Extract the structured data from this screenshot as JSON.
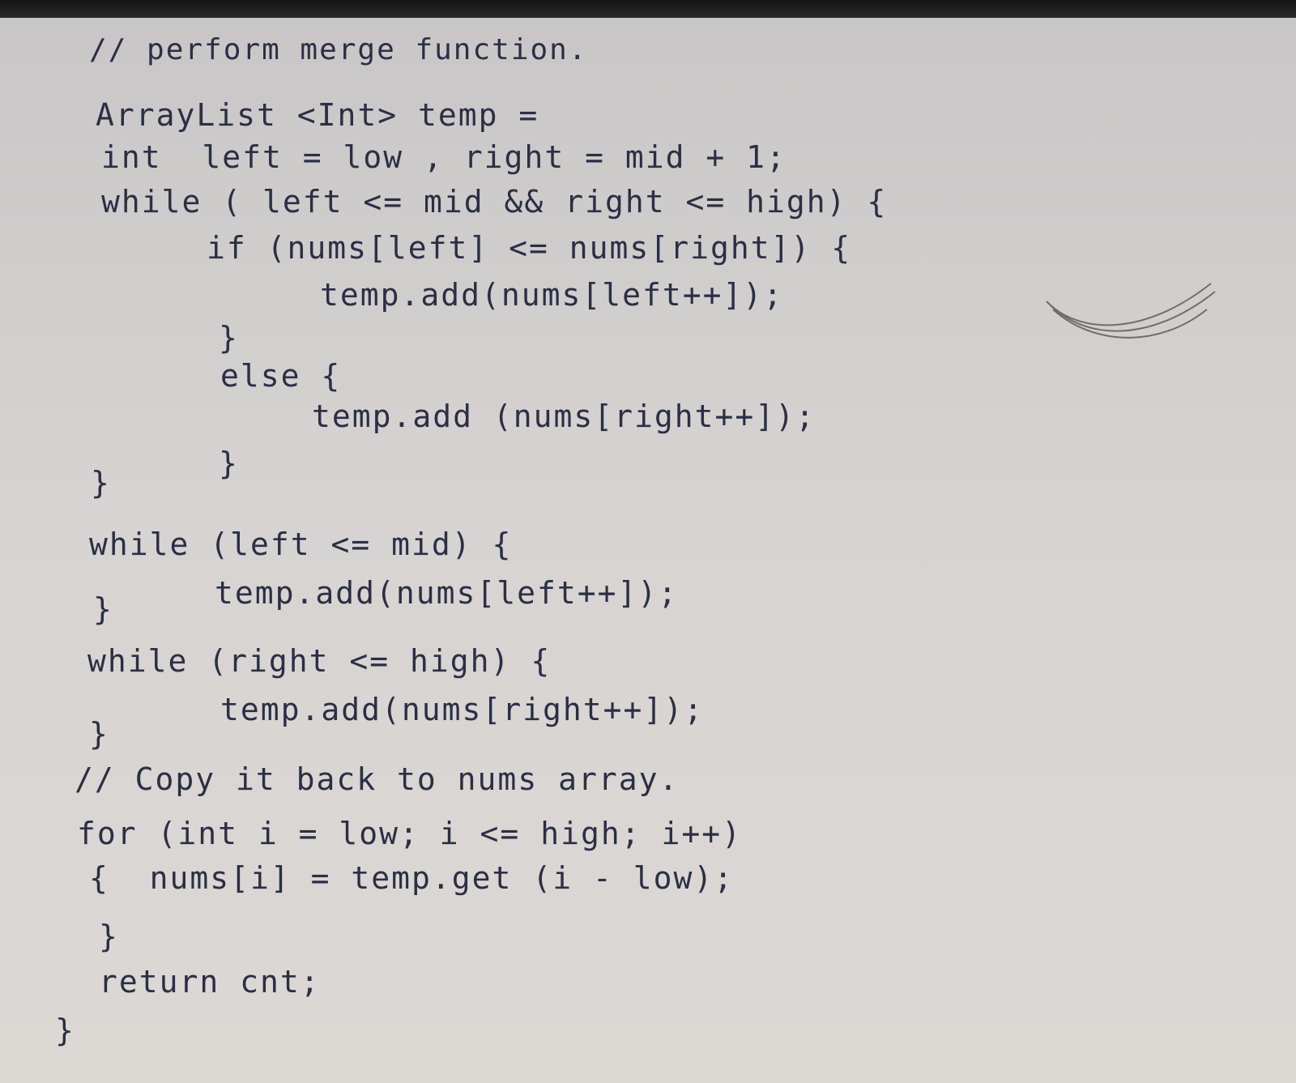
{
  "lines": [
    "// perform merge function.",
    "ArrayList <Int> temp =",
    "int  left = low , right = mid + 1;",
    "while ( left <= mid && right <= high) {",
    "if (nums[left] <= nums[right]) {",
    "temp.add(nums[left++]);",
    "}",
    "else {",
    "temp.add (nums[right++]);",
    "}",
    "}",
    "while (left <= mid) {",
    "temp.add(nums[left++]);",
    "}",
    "while (right <= high) {",
    "temp.add(nums[right++]);",
    "}",
    "// Copy it back to nums array.",
    "for (int i = low; i <= high; i++)",
    "{  nums[i] = temp.get (i - low);",
    "}",
    "return cnt;",
    "}"
  ],
  "colors": {
    "ink": "#2b2f45",
    "paper": "#d6d3d2",
    "pencil": "#6f6c6c"
  },
  "decoration": [
    "pencil-scribble"
  ]
}
